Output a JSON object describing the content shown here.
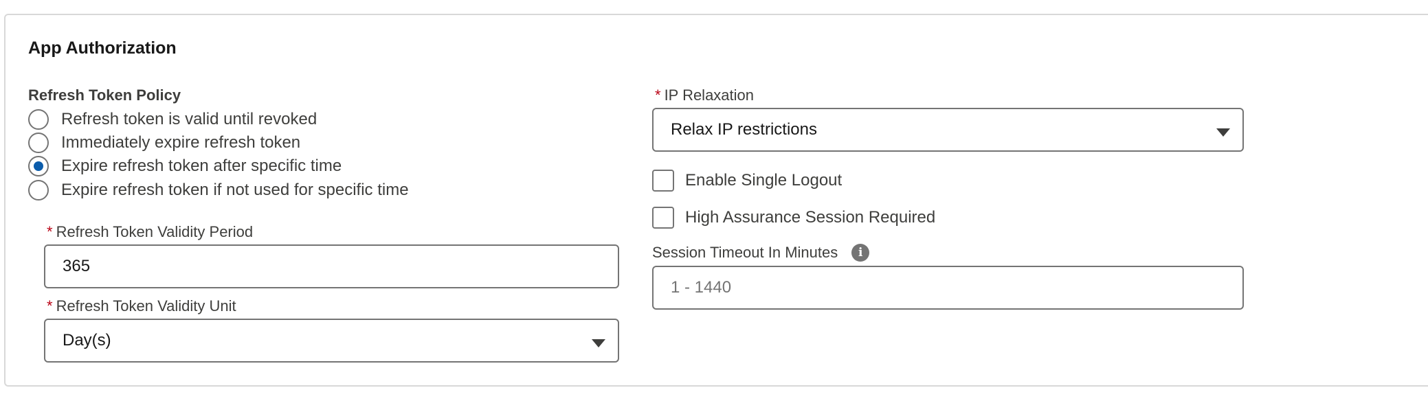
{
  "section": {
    "title": "App Authorization"
  },
  "refresh_token_policy": {
    "label": "Refresh Token Policy",
    "options": [
      {
        "label": "Refresh token is valid until revoked",
        "selected": false
      },
      {
        "label": "Immediately expire refresh token",
        "selected": false
      },
      {
        "label": "Expire refresh token after specific time",
        "selected": true
      },
      {
        "label": "Expire refresh token if not used for specific time",
        "selected": false
      }
    ]
  },
  "validity_period": {
    "required_marker": "*",
    "label": "Refresh Token Validity Period",
    "value": "365"
  },
  "validity_unit": {
    "required_marker": "*",
    "label": "Refresh Token Validity Unit",
    "selected": "Day(s)"
  },
  "ip_relaxation": {
    "required_marker": "*",
    "label": "IP Relaxation",
    "selected": "Relax IP restrictions"
  },
  "checkboxes": {
    "single_logout": {
      "label": "Enable Single Logout",
      "checked": false
    },
    "high_assurance": {
      "label": "High Assurance Session Required",
      "checked": false
    }
  },
  "session_timeout": {
    "label": "Session Timeout In Minutes",
    "info_icon": "info-icon",
    "placeholder": "1 - 1440",
    "value": ""
  },
  "colors": {
    "required": "#ba0517",
    "radio_selected": "#0b5cab",
    "border": "#747474"
  }
}
